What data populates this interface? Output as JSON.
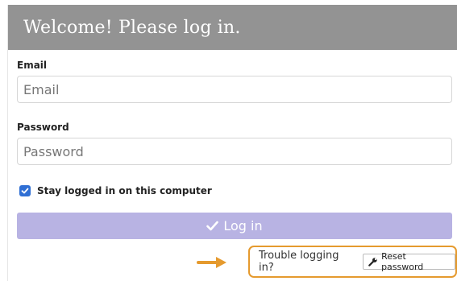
{
  "header": {
    "title": "Welcome! Please log in."
  },
  "form": {
    "email": {
      "label": "Email",
      "placeholder": "Email",
      "value": ""
    },
    "password": {
      "label": "Password",
      "placeholder": "Password",
      "value": ""
    },
    "remember": {
      "label": "Stay logged in on this computer",
      "checked": true
    },
    "submit": {
      "label": "Log in",
      "icon": "check-icon"
    }
  },
  "help": {
    "trouble_text": "Trouble logging in?",
    "reset_label": "Reset password",
    "reset_icon": "wrench-icon"
  },
  "colors": {
    "header_bg": "#939393",
    "button_bg": "#b8b3e3",
    "checkbox": "#2f6fd4",
    "highlight": "#e59a2e"
  }
}
